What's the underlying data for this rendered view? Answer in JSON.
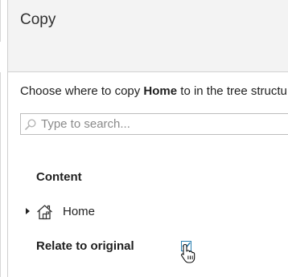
{
  "dialog": {
    "title": "Copy",
    "instruction_prefix": "Choose where to copy ",
    "instruction_item": "Home",
    "instruction_suffix": " to in the tree structu"
  },
  "search": {
    "placeholder": "Type to search...",
    "value": ""
  },
  "content_section": {
    "heading": "Content",
    "tree": [
      {
        "label": "Home",
        "icon": "home-icon",
        "expanded": false
      }
    ]
  },
  "relate": {
    "label": "Relate to original",
    "checked": true
  },
  "colors": {
    "header_bg": "#f3f3f3",
    "checkbox_accent": "#2a7fb0"
  }
}
